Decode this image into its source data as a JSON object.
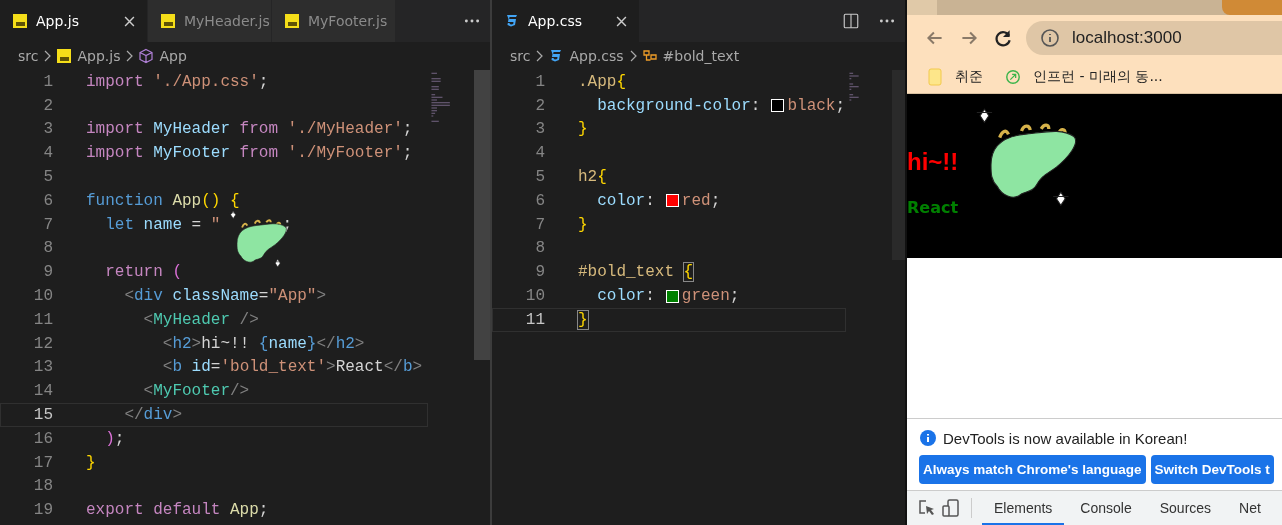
{
  "editors": [
    {
      "tabs": [
        {
          "label": "App.js",
          "selected": true
        },
        {
          "label": "MyHeader.js",
          "selected": false
        },
        {
          "label": "MyFooter.js",
          "selected": false
        }
      ],
      "breadcrumb": [
        "src",
        "App.js",
        "App"
      ],
      "lines": [
        {
          "number": "1",
          "current": false,
          "covered": false,
          "tokens": [
            {
              "kind": "kw",
              "text": "import"
            },
            {
              "kind": "str",
              "text": " './App.css'"
            },
            {
              "kind": "plain",
              "text": ";"
            }
          ]
        },
        {
          "number": "2",
          "current": false,
          "covered": false
        },
        {
          "number": "3",
          "current": false,
          "covered": false,
          "tokens": [
            {
              "kind": "kw",
              "text": "import"
            },
            {
              "kind": "var",
              "text": " MyHeader"
            },
            {
              "kind": "kw",
              "text": " from"
            },
            {
              "kind": "str",
              "text": " './MyHeader'"
            },
            {
              "kind": "plain",
              "text": ";"
            }
          ]
        },
        {
          "number": "4",
          "current": false,
          "covered": false,
          "tokens": [
            {
              "kind": "kw",
              "text": "import"
            },
            {
              "kind": "var",
              "text": " MyFooter"
            },
            {
              "kind": "kw",
              "text": " from"
            },
            {
              "kind": "str",
              "text": " './MyFooter'"
            },
            {
              "kind": "plain",
              "text": ";"
            }
          ]
        },
        {
          "number": "5",
          "current": false,
          "covered": false
        },
        {
          "number": "6",
          "current": false,
          "covered": false,
          "tokens": [
            {
              "kind": "decl",
              "text": "function"
            },
            {
              "kind": "fn",
              "text": " App"
            },
            {
              "kind": "brace",
              "text": "()"
            },
            {
              "kind": "brace",
              "text": " {"
            }
          ]
        },
        {
          "number": "7",
          "current": false,
          "covered": true,
          "tokens": [
            {
              "kind": "decl",
              "text": "  let"
            },
            {
              "kind": "var",
              "text": " name"
            },
            {
              "kind": "plain",
              "text": " ="
            },
            {
              "kind": "str",
              "text": " \""
            }
          ],
          "tokens_after": [
            {
              "kind": "plain",
              "text": ";"
            }
          ]
        },
        {
          "number": "8",
          "current": false,
          "covered": false
        },
        {
          "number": "9",
          "current": false,
          "covered": false,
          "tokens": [
            {
              "kind": "kw",
              "text": "  return"
            },
            {
              "kind": "paren",
              "text": " ("
            }
          ]
        },
        {
          "number": "10",
          "current": false,
          "covered": false,
          "tokens": [
            {
              "kind": "punct",
              "text": "    <"
            },
            {
              "kind": "tag",
              "text": "div"
            },
            {
              "kind": "var",
              "text": " className"
            },
            {
              "kind": "plain",
              "text": "="
            },
            {
              "kind": "str",
              "text": "\"App\""
            },
            {
              "kind": "punct",
              "text": ">"
            }
          ]
        },
        {
          "number": "11",
          "current": false,
          "covered": false,
          "tokens": [
            {
              "kind": "punct",
              "text": "      <"
            },
            {
              "kind": "comp",
              "text": "MyHeader"
            },
            {
              "kind": "punct",
              "text": " />"
            }
          ]
        },
        {
          "number": "12",
          "current": false,
          "covered": false,
          "tokens": [
            {
              "kind": "punct",
              "text": "        <"
            },
            {
              "kind": "tag",
              "text": "h2"
            },
            {
              "kind": "punct",
              "text": ">"
            },
            {
              "kind": "plain",
              "text": "hi~!!"
            },
            {
              "kind": "tag",
              "text": " {"
            },
            {
              "kind": "var",
              "text": "name"
            },
            {
              "kind": "tag",
              "text": "}"
            },
            {
              "kind": "punct",
              "text": "</"
            },
            {
              "kind": "tag",
              "text": "h2"
            },
            {
              "kind": "punct",
              "text": ">"
            }
          ]
        },
        {
          "number": "13",
          "current": false,
          "covered": false,
          "tokens": [
            {
              "kind": "punct",
              "text": "        <"
            },
            {
              "kind": "tag",
              "text": "b"
            },
            {
              "kind": "var",
              "text": " id"
            },
            {
              "kind": "plain",
              "text": "="
            },
            {
              "kind": "str",
              "text": "'bold_text'"
            },
            {
              "kind": "punct",
              "text": ">"
            },
            {
              "kind": "plain",
              "text": "React"
            },
            {
              "kind": "punct",
              "text": "</"
            },
            {
              "kind": "tag",
              "text": "b"
            },
            {
              "kind": "punct",
              "text": ">"
            }
          ]
        },
        {
          "number": "14",
          "current": false,
          "covered": false,
          "tokens": [
            {
              "kind": "punct",
              "text": "      <"
            },
            {
              "kind": "comp",
              "text": "MyFooter"
            },
            {
              "kind": "punct",
              "text": "/>"
            }
          ]
        },
        {
          "number": "15",
          "current": true,
          "covered": false,
          "tokens": [
            {
              "kind": "punct",
              "text": "    </"
            },
            {
              "kind": "tag",
              "text": "div"
            },
            {
              "kind": "punct",
              "text": ">"
            }
          ]
        },
        {
          "number": "16",
          "current": false,
          "covered": false,
          "tokens": [
            {
              "kind": "paren",
              "text": "  )"
            },
            {
              "kind": "plain",
              "text": ";"
            }
          ]
        },
        {
          "number": "17",
          "current": false,
          "covered": false,
          "tokens": [
            {
              "kind": "brace",
              "text": "}"
            }
          ]
        },
        {
          "number": "18",
          "current": false,
          "covered": false
        },
        {
          "number": "19",
          "current": false,
          "covered": false,
          "tokens": [
            {
              "kind": "kw",
              "text": "export"
            },
            {
              "kind": "kw",
              "text": " default"
            },
            {
              "kind": "fn",
              "text": " App"
            },
            {
              "kind": "plain",
              "text": ";"
            }
          ]
        }
      ]
    },
    {
      "tabs": [
        {
          "label": "App.css",
          "selected": true
        }
      ],
      "breadcrumb": [
        "src",
        "App.css",
        "#bold_text"
      ],
      "lines": [
        {
          "number": "1",
          "current": false,
          "covered": false,
          "tokens": [
            {
              "kind": "sel",
              "text": ".App"
            },
            {
              "kind": "brace",
              "text": "{"
            }
          ]
        },
        {
          "number": "2",
          "current": false,
          "covered": false,
          "tokens": [
            {
              "kind": "var",
              "text": "  background-color"
            },
            {
              "kind": "plain",
              "text": ":"
            },
            {
              "kind": "swatch",
              "color": "#000000"
            },
            {
              "kind": "str",
              "text": "black"
            },
            {
              "kind": "plain",
              "text": ";"
            }
          ]
        },
        {
          "number": "3",
          "current": false,
          "covered": false,
          "tokens": [
            {
              "kind": "brace",
              "text": "}"
            }
          ]
        },
        {
          "number": "4",
          "current": false,
          "covered": false
        },
        {
          "number": "5",
          "current": false,
          "covered": false,
          "tokens": [
            {
              "kind": "sel",
              "text": "h2"
            },
            {
              "kind": "brace",
              "text": "{"
            }
          ]
        },
        {
          "number": "6",
          "current": false,
          "covered": false,
          "tokens": [
            {
              "kind": "var",
              "text": "  color"
            },
            {
              "kind": "plain",
              "text": ":"
            },
            {
              "kind": "swatch",
              "color": "#ff0000"
            },
            {
              "kind": "str",
              "text": "red"
            },
            {
              "kind": "plain",
              "text": ";"
            }
          ]
        },
        {
          "number": "7",
          "current": false,
          "covered": false,
          "tokens": [
            {
              "kind": "brace",
              "text": "}"
            }
          ]
        },
        {
          "number": "8",
          "current": false,
          "covered": false
        },
        {
          "number": "9",
          "current": false,
          "covered": false,
          "tokens": [
            {
              "kind": "sel",
              "text": "#bold_text"
            },
            {
              "kind": "match",
              "text": " {"
            }
          ]
        },
        {
          "number": "10",
          "current": false,
          "covered": false,
          "tokens": [
            {
              "kind": "var",
              "text": "  color"
            },
            {
              "kind": "plain",
              "text": ":"
            },
            {
              "kind": "swatch",
              "color": "#008000"
            },
            {
              "kind": "str",
              "text": "green"
            },
            {
              "kind": "plain",
              "text": ";"
            }
          ]
        },
        {
          "number": "11",
          "current": true,
          "covered": false,
          "tokens": [
            {
              "kind": "match",
              "text": "}"
            }
          ]
        }
      ]
    }
  ],
  "browser": {
    "url": "localhost:3000",
    "bookmarks": [
      {
        "label": "취준",
        "kind": "folder"
      },
      {
        "label": "인프런 - 미래의 동...",
        "kind": "site"
      }
    ],
    "page": {
      "heading": "hi~!!",
      "bold_text": "React"
    },
    "devtools": {
      "notice": "DevTools is now available in Korean!",
      "buttons": [
        "Always match Chrome's language",
        "Switch DevTools t"
      ],
      "tabs": [
        {
          "label": "Elements",
          "selected": true
        },
        {
          "label": "Console",
          "selected": false
        },
        {
          "label": "Sources",
          "selected": false
        },
        {
          "label": "Net",
          "selected": false
        }
      ]
    }
  }
}
